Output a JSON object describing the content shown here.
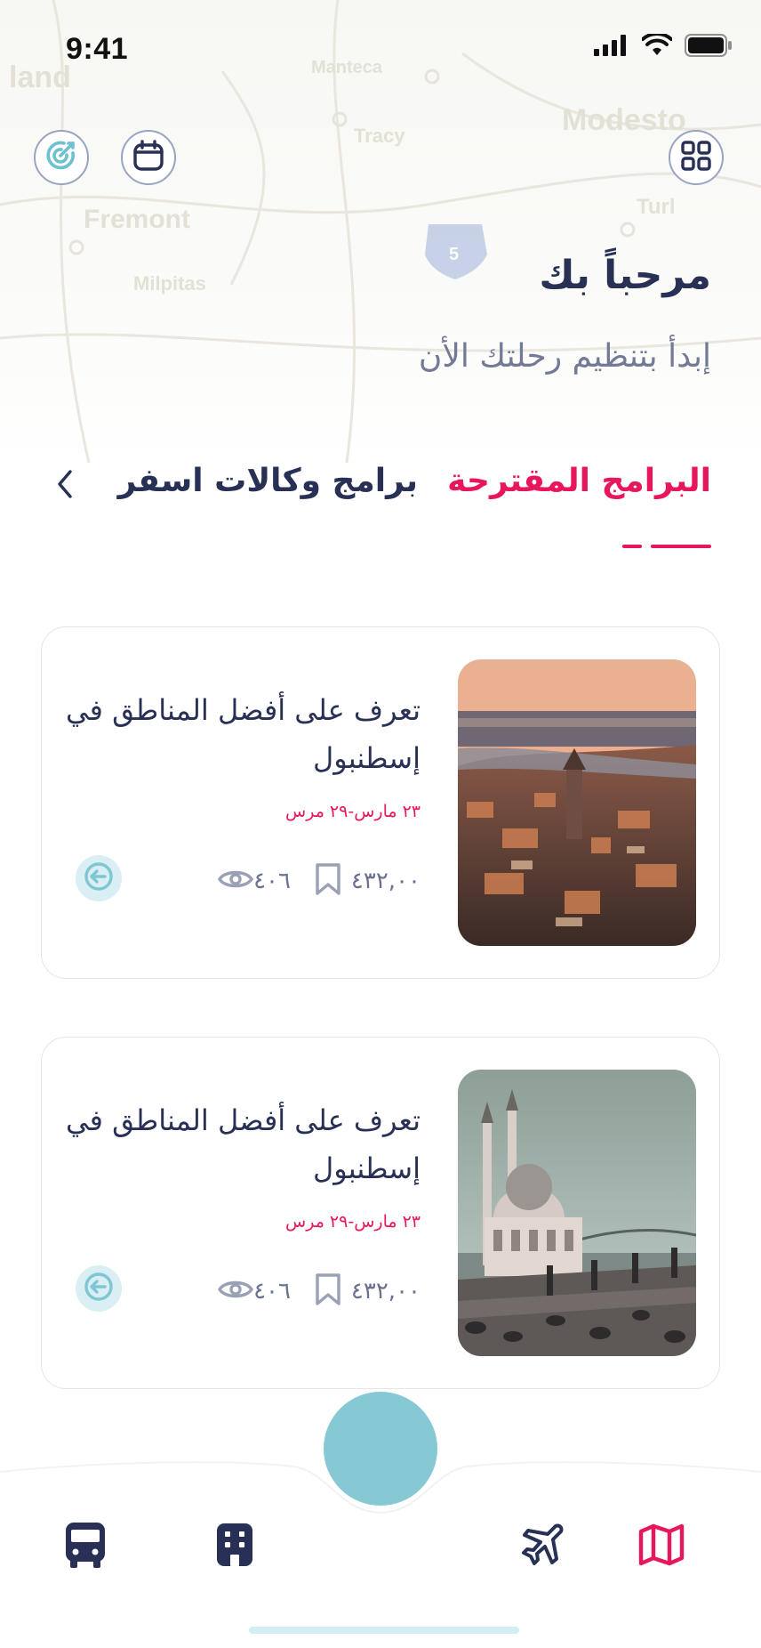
{
  "status_bar": {
    "time": "9:41"
  },
  "header": {
    "greeting": "مرحباً بك",
    "subtitle": "إبدأ بتنظيم رحلتك الأن"
  },
  "top_buttons": [
    {
      "icon": "grid-icon"
    },
    {
      "icon": "calendar-icon"
    },
    {
      "icon": "target-icon"
    }
  ],
  "map_labels": [
    "land",
    "Manteca",
    "Modesto",
    "Tracy",
    "Fremont",
    "Turl",
    "Milpitas",
    "5"
  ],
  "tabs": {
    "active": "البرامج المقترحة",
    "other": "برامج وكالات اسفر"
  },
  "cards": [
    {
      "title": "تعرف على أفضل المناطق في إسطنبول",
      "date": "٢٣ مارس-٢٩ مرس",
      "bookmarks": "٤٣٢,٠٠",
      "views": "٤٠٦",
      "image": "istanbul-galata-photo"
    },
    {
      "title": "تعرف على أفضل المناطق في إسطنبول",
      "date": "٢٣ مارس-٢٩ مرس",
      "bookmarks": "٤٣٢,٠٠",
      "views": "٤٠٦",
      "image": "istanbul-mosque-photo"
    }
  ],
  "bottom_nav": [
    {
      "icon": "map-icon",
      "active": true
    },
    {
      "icon": "plane-icon",
      "active": false
    },
    {
      "icon": "building-icon",
      "active": false
    },
    {
      "icon": "bus-icon",
      "active": false
    }
  ],
  "colors": {
    "accent": "#e8175d",
    "navy": "#283055",
    "teal": "#86c9d5"
  }
}
